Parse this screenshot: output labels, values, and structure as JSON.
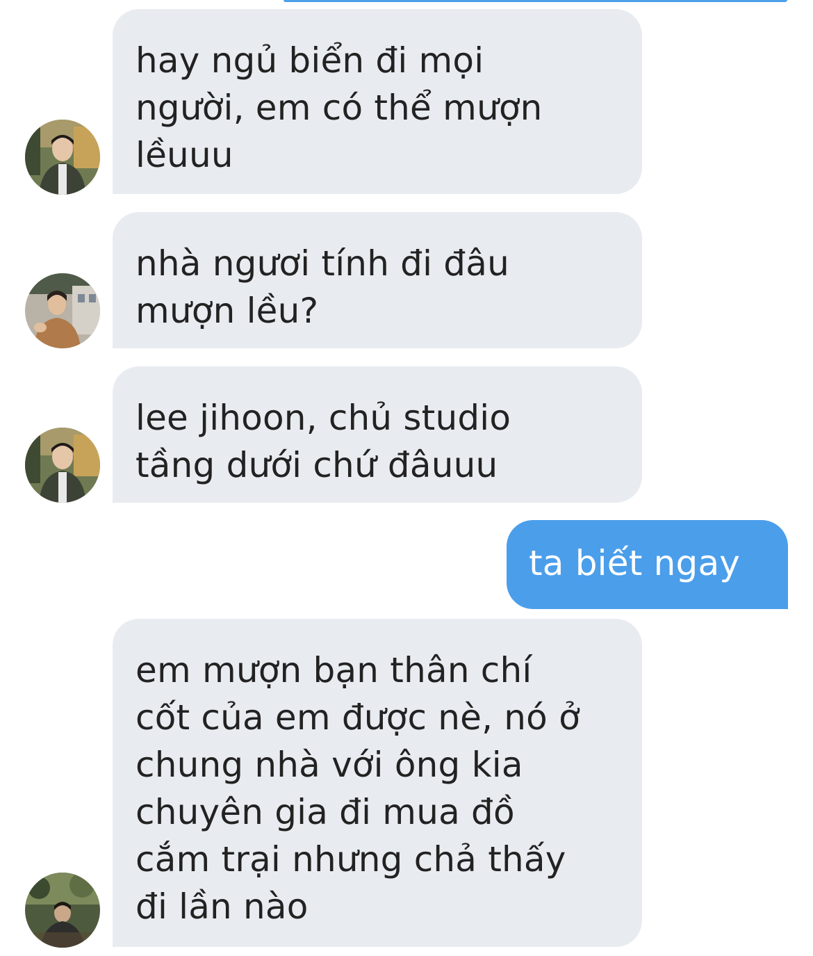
{
  "conversation": {
    "messages": [
      {
        "direction": "incoming",
        "lines": [
          "hay ngủ biển đi mọi",
          "người, em có thể mượn",
          "lềuuu"
        ]
      },
      {
        "direction": "incoming",
        "lines": [
          "nhà ngươi tính đi đâu",
          "mượn lều?"
        ]
      },
      {
        "direction": "incoming",
        "lines": [
          "lee jihoon, chủ studio",
          "tầng dưới chứ đâuuu"
        ]
      },
      {
        "direction": "outgoing",
        "lines": [
          "ta biết ngay"
        ]
      },
      {
        "direction": "incoming",
        "lines": [
          "em mượn bạn thân chí",
          "cốt của em được nè, nó ở",
          "chung nhà với ông kia",
          "chuyên gia đi mua đồ",
          "cắm trại nhưng chả thấy",
          "đi lần nào"
        ]
      }
    ]
  },
  "colors": {
    "incoming_bubble": "#e8ecf0",
    "outgoing_bubble": "#4b9eea",
    "incoming_text": "#222222",
    "outgoing_text": "#ffffff"
  }
}
